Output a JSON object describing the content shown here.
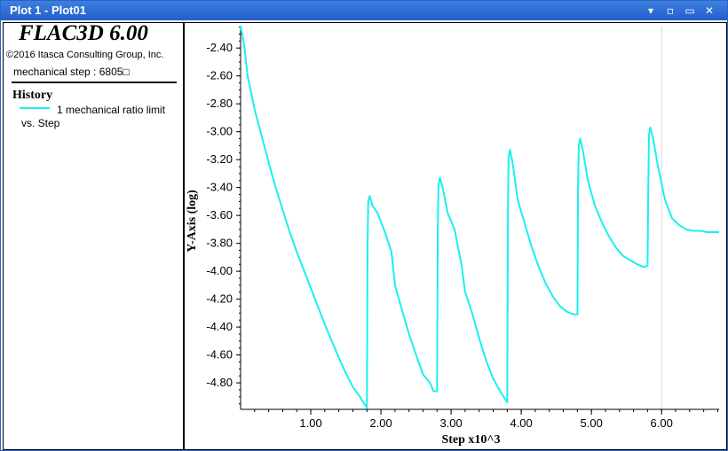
{
  "window": {
    "title": "Plot 1 - Plot01",
    "buttons": {
      "menu": "▾",
      "minimize": "▫",
      "restore": "▭",
      "close": "✕"
    }
  },
  "legend_panel": {
    "app_title": "FLAC3D 6.00",
    "copyright": "©2016 Itasca Consulting Group, Inc.",
    "step_text": "mechanical step : 6805□",
    "history_heading": "History",
    "entry_line1": "1 mechanical ratio limit",
    "entry_line2": "vs. Step"
  },
  "colors": {
    "series": "#19f0f0",
    "titlebar": "#2b63c9",
    "axis": "#000000"
  },
  "chart_data": {
    "type": "line",
    "xlabel": "Step x10^3",
    "ylabel": "Y-Axis (log)",
    "xlim": [
      0.0,
      6.82
    ],
    "ylim": [
      -4.99,
      -2.24
    ],
    "xticks": [
      1.0,
      2.0,
      3.0,
      4.0,
      5.0,
      6.0
    ],
    "xtick_labels": [
      "1.00",
      "2.00",
      "3.00",
      "4.00",
      "5.00",
      "6.00"
    ],
    "yticks": [
      -2.4,
      -2.6,
      -2.8,
      -3.0,
      -3.2,
      -3.4,
      -3.6,
      -3.8,
      -4.0,
      -4.2,
      -4.4,
      -4.6,
      -4.8
    ],
    "ytick_labels": [
      "-2.40",
      "-2.60",
      "-2.80",
      "-3.00",
      "-3.20",
      "-3.40",
      "-3.60",
      "-3.80",
      "-4.00",
      "-4.20",
      "-4.40",
      "-4.60",
      "-4.80"
    ],
    "grid": "vertical line at 6.00",
    "series": [
      {
        "x": [
          0.0,
          0.05,
          0.1,
          0.2,
          0.3,
          0.4,
          0.5,
          0.6,
          0.7,
          0.8,
          0.9,
          1.0,
          1.1,
          1.2,
          1.3,
          1.4,
          1.5,
          1.6,
          1.7,
          1.75,
          1.8,
          1.81,
          1.82,
          1.84,
          1.88,
          1.95,
          2.05,
          2.15,
          2.2,
          2.3,
          2.4,
          2.5,
          2.6,
          2.7,
          2.75,
          2.8,
          2.81,
          2.82,
          2.84,
          2.88,
          2.95,
          3.05,
          3.15,
          3.2,
          3.3,
          3.4,
          3.5,
          3.6,
          3.7,
          3.75,
          3.8,
          3.81,
          3.82,
          3.84,
          3.88,
          3.95,
          4.05,
          4.15,
          4.25,
          4.35,
          4.45,
          4.55,
          4.65,
          4.75,
          4.8,
          4.81,
          4.82,
          4.84,
          4.88,
          4.95,
          5.05,
          5.15,
          5.25,
          5.35,
          5.45,
          5.55,
          5.65,
          5.75,
          5.8,
          5.81,
          5.82,
          5.84,
          5.88,
          5.95,
          6.05,
          6.15,
          6.25,
          6.35,
          6.45,
          6.55,
          6.65,
          6.75,
          6.82
        ],
        "y": [
          -2.24,
          -2.38,
          -2.6,
          -2.84,
          -3.03,
          -3.22,
          -3.4,
          -3.56,
          -3.72,
          -3.86,
          -3.99,
          -4.12,
          -4.25,
          -4.38,
          -4.5,
          -4.62,
          -4.73,
          -4.83,
          -4.9,
          -4.94,
          -4.98,
          -3.8,
          -3.5,
          -3.46,
          -3.53,
          -3.58,
          -3.71,
          -3.86,
          -4.1,
          -4.28,
          -4.45,
          -4.6,
          -4.74,
          -4.8,
          -4.86,
          -4.86,
          -3.7,
          -3.38,
          -3.33,
          -3.4,
          -3.58,
          -3.7,
          -3.96,
          -4.15,
          -4.3,
          -4.48,
          -4.64,
          -4.77,
          -4.86,
          -4.9,
          -4.94,
          -3.56,
          -3.18,
          -3.13,
          -3.23,
          -3.49,
          -3.66,
          -3.83,
          -3.97,
          -4.09,
          -4.18,
          -4.25,
          -4.29,
          -4.31,
          -4.31,
          -3.41,
          -3.1,
          -3.05,
          -3.14,
          -3.35,
          -3.53,
          -3.65,
          -3.75,
          -3.83,
          -3.89,
          -3.92,
          -3.95,
          -3.97,
          -3.96,
          -3.4,
          -3.02,
          -2.97,
          -3.05,
          -3.25,
          -3.49,
          -3.62,
          -3.67,
          -3.7,
          -3.71,
          -3.71,
          -3.72,
          -3.72,
          -3.72
        ]
      }
    ]
  }
}
